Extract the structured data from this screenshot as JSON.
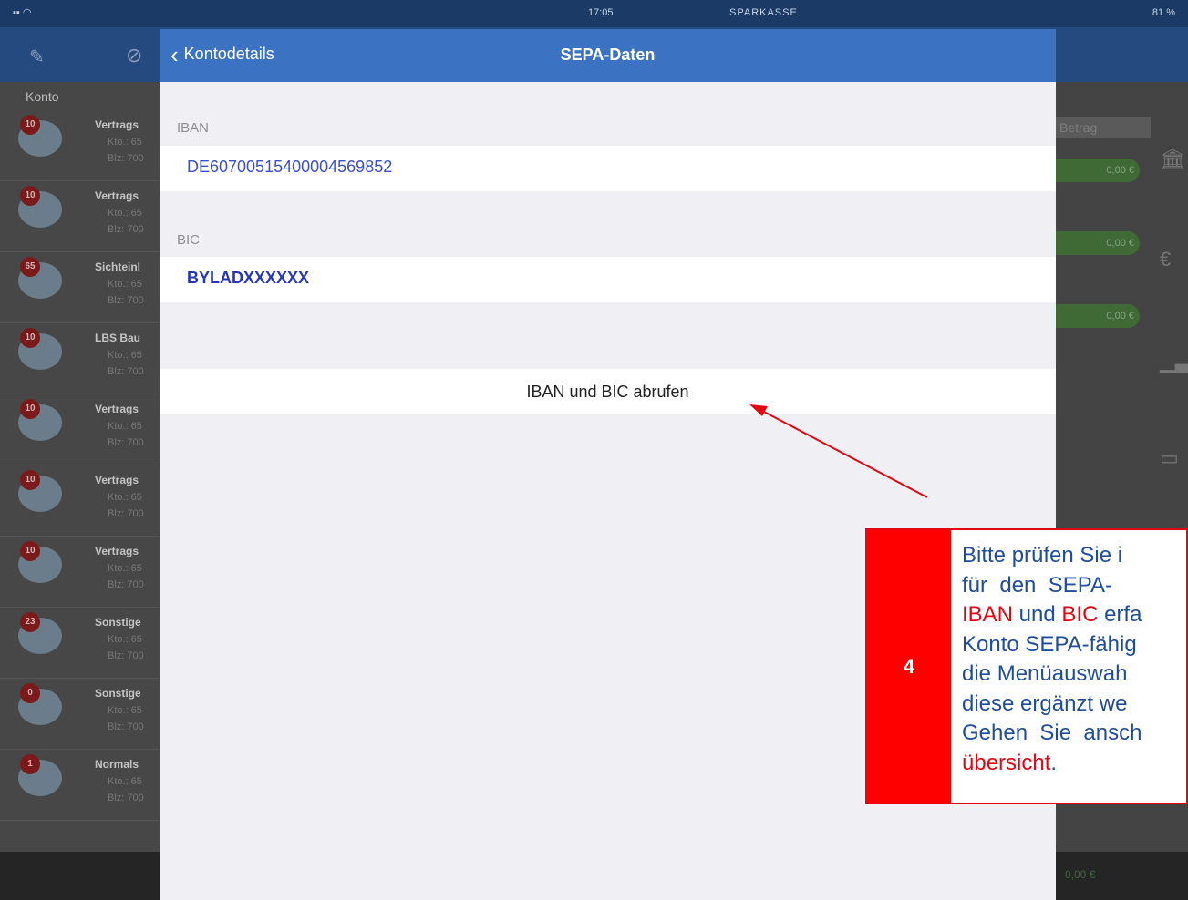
{
  "status": {
    "time": "17:05",
    "brand": "SPARKASSE",
    "battery": "81 %"
  },
  "sidebar": {
    "header": "Konto",
    "accounts": [
      {
        "badge": "10",
        "name": "Vertrags",
        "line1": "Kto.: 65",
        "line2": "Blz: 700"
      },
      {
        "badge": "10",
        "name": "Vertrags",
        "line1": "Kto.: 65",
        "line2": "Blz: 700"
      },
      {
        "badge": "65",
        "name": "Sichteinl",
        "line1": "Kto.: 65",
        "line2": "Blz: 700"
      },
      {
        "badge": "10",
        "name": "LBS Bau",
        "line1": "Kto.: 65",
        "line2": "Blz: 700"
      },
      {
        "badge": "10",
        "name": "Vertrags",
        "line1": "Kto.: 65",
        "line2": "Blz: 700"
      },
      {
        "badge": "10",
        "name": "Vertrags",
        "line1": "Kto.: 65",
        "line2": "Blz: 700"
      },
      {
        "badge": "10",
        "name": "Vertrags",
        "line1": "Kto.: 65",
        "line2": "Blz: 700"
      },
      {
        "badge": "23",
        "name": "Sonstige",
        "line1": "Kto.: 65",
        "line2": "Blz: 700"
      },
      {
        "badge": "0",
        "name": "Sonstige",
        "line1": "Kto.: 65",
        "line2": "Blz: 700"
      },
      {
        "badge": "1",
        "name": "Normals",
        "line1": "Kto.: 65",
        "line2": "Blz: 700"
      }
    ]
  },
  "right_panel": {
    "column_header": "Betrag",
    "amounts": [
      "0,00 €",
      "0,00 €",
      "0,00 €"
    ],
    "icons": [
      "bank-icon",
      "euro-icon",
      "chart-icon",
      "folder-icon"
    ]
  },
  "bottom": {
    "value": "0,00 €"
  },
  "modal": {
    "back_label": "Kontodetails",
    "title": "SEPA-Daten",
    "iban_label": "IBAN",
    "iban_value": "DE60700515400004569852",
    "bic_label": "BIC",
    "bic_value": "BYLADXXXXXX",
    "action_label": "IBAN und BIC abrufen"
  },
  "callout": {
    "number": "4",
    "lines": [
      "Bitte prüfen Sie i",
      "für  den  SEPA-",
      [
        "IBAN",
        " und ",
        "BIC",
        " erfa"
      ],
      "Konto SEPA-fähig",
      "die Menüauswah",
      "diese ergänzt we",
      "Gehen  Sie  ansch",
      [
        "übersicht",
        "."
      ]
    ],
    "line3": {
      "iban": "IBAN",
      "und": " und ",
      "bic": "BIC",
      "rest": " erfa"
    },
    "line8": {
      "word": "übersicht",
      "dot": "."
    },
    "colors": {
      "box": "#ff0000",
      "text": "#1f4d9a",
      "highlight": "#e30613"
    }
  },
  "colors": {
    "navbar": "#3b73c2",
    "iban": "#3a4fd1",
    "bic": "#2536b8"
  }
}
